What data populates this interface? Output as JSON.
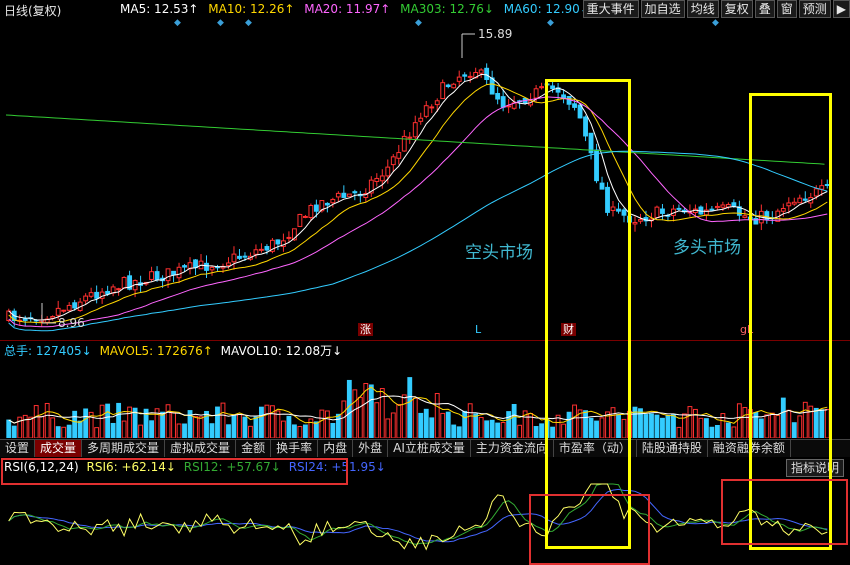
{
  "header": {
    "period": "日线(复权)",
    "ma": [
      {
        "label": "MA5: 12.53↑",
        "color": "#ffffff"
      },
      {
        "label": "MA10: 12.26↑",
        "color": "#ffd700"
      },
      {
        "label": "MA20: 11.97↑",
        "color": "#ff66ff"
      },
      {
        "label": "MA303: 12.76↓",
        "color": "#33cc33"
      },
      {
        "label": "MA60: 12.90↓",
        "color": "#33ccff"
      }
    ],
    "toolbar": [
      "重大事件",
      "加自选",
      "均线",
      "复权",
      "叠",
      "窗",
      "预测",
      "▶"
    ]
  },
  "main": {
    "high_label": "15.89",
    "low_label": "8.96",
    "annotations": {
      "bear": "空头市场",
      "bull": "多头市场"
    },
    "markers": {
      "zhang": "涨",
      "L": "L",
      "cai": "财",
      "gL": "gL"
    }
  },
  "volume": {
    "legend": [
      {
        "label": "总手: 127405↓",
        "color": "#33ccff"
      },
      {
        "label": "MAVOL5: 172676↑",
        "color": "#ffd700"
      },
      {
        "label": "MAVOL10: 12.08万↓",
        "color": "#ffffff"
      }
    ]
  },
  "tabs": [
    "设置",
    "成交量",
    "多周期成交量",
    "虚拟成交量",
    "金额",
    "换手率",
    "内盘",
    "外盘",
    "AI立桩成交量",
    "主力资金流向",
    "市盈率（动）",
    "陆股通持股",
    "融资融券余额"
  ],
  "rsi": {
    "legend": [
      {
        "label": "RSI(6,12,24)",
        "color": "#ffffff"
      },
      {
        "label": "RSI6: +62.14↓",
        "color": "#ffff66"
      },
      {
        "label": "RSI12: +57.67↓",
        "color": "#33aa33"
      },
      {
        "label": "RSI24: +51.95↓",
        "color": "#4466ff"
      }
    ],
    "help": "指标说明"
  }
}
